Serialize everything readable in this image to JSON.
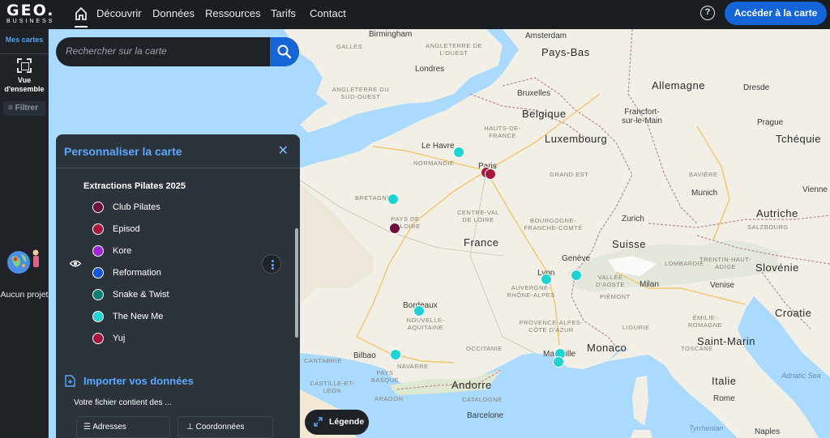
{
  "brand": {
    "logo_text": "GEO.",
    "logo_sub": "BUSINESS"
  },
  "nav": {
    "items": [
      "Découvrir",
      "Données",
      "Ressources",
      "Tarifs",
      "Contact"
    ],
    "help": "?",
    "cta": "Accéder à la carte"
  },
  "sidebar": {
    "my_maps": "Mes cartes",
    "overview": "Vue d'ensemble",
    "filter": "Filtrer",
    "no_project": "Aucun projet"
  },
  "search": {
    "placeholder": "Rechercher sur la carte"
  },
  "panel": {
    "title": "Personnaliser la carte",
    "layer_title": "Extractions Pilates 2025",
    "legend": [
      {
        "label": "Club Pilates",
        "color": "#6d0a3e"
      },
      {
        "label": "Episod",
        "color": "#a8163e"
      },
      {
        "label": "Kore",
        "color": "#a023d8"
      },
      {
        "label": "Reformation",
        "color": "#1558d6"
      },
      {
        "label": "Snake & Twist",
        "color": "#0e7f73"
      },
      {
        "label": "The New Me",
        "color": "#1fd3d3"
      },
      {
        "label": "Yuj",
        "color": "#a8163e"
      }
    ],
    "import_title": "Importer vos données",
    "file_contains": "Votre fichier contient des ...",
    "option_addresses": "Adresses",
    "option_coordinates": "Coordonnées"
  },
  "legend_button": "Légende",
  "map": {
    "countries": [
      "Pays-Bas",
      "Allemagne",
      "Belgique",
      "Luxembourg",
      "Tchéquie",
      "France",
      "Suisse",
      "Autriche",
      "Slovénie",
      "Croatie",
      "Italie",
      "Andorre",
      "Monaco",
      "Saint-Marin"
    ],
    "cities": [
      "Birmingham",
      "Amsterdam",
      "Londres",
      "Dresde",
      "Bruxelles",
      "Francfort-sur-le-Main",
      "Prague",
      "Le Havre",
      "Paris",
      "Munich",
      "Vienne",
      "Zurich",
      "Genève",
      "Lyon",
      "Milan",
      "Venise",
      "Bordeaux",
      "Bilbao",
      "Marseille",
      "Rome",
      "Barcelone",
      "Naples"
    ],
    "regions": [
      "ANGLETERRE DE L'OUEST",
      "ANGLETERRE DU SUD-OUEST",
      "HAUTS-DE-FRANCE",
      "NORMANDIE",
      "GRAND EST",
      "BRETAGNE",
      "CENTRE-VAL DE LOIRE",
      "PAYS DE LA LOIRE",
      "BOURGOGNE-FRANCHE-COMTÉ",
      "AUVERGNE-RHÔNE-ALPES",
      "NOUVELLE-AQUITAINE",
      "OCCITANIE",
      "PROVENCE-ALPES-CÔTE D'AZUR",
      "VALLÉE D'AOSTE",
      "PIÉMONT",
      "LOMBARDIE",
      "TRENTIN-HAUT-ADIGE",
      "ÉMILIE-ROMAGNE",
      "TOSCANE",
      "LIGURIE",
      "CATALOGNE",
      "CASTILLE-ET-LEÓN",
      "ARAGON",
      "NAVARRE",
      "PAYS BASQUE",
      "CANTABRIE",
      "SALZBOURG",
      "BAVIÈRE",
      "GALLES"
    ],
    "seas": [
      "Adriatic Sea",
      "Tyrrhenian"
    ],
    "marker_colors": {
      "club": "#6d0a3e",
      "episod": "#a8163e",
      "newme": "#1fd3d3"
    }
  }
}
